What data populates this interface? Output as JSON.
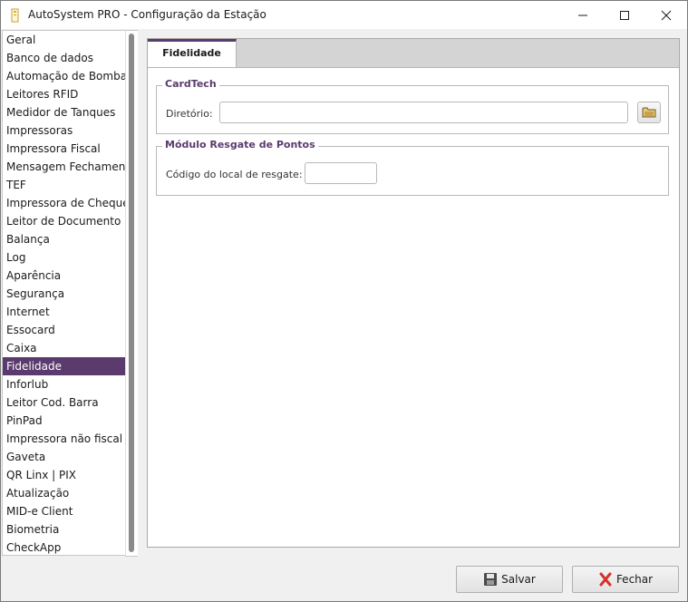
{
  "window": {
    "title": "AutoSystem PRO - Configuração da Estação"
  },
  "sidebar": {
    "selected_index": 18,
    "items": [
      {
        "label": "Geral"
      },
      {
        "label": "Banco de dados"
      },
      {
        "label": "Automação de Bombas"
      },
      {
        "label": "Leitores RFID"
      },
      {
        "label": "Medidor de Tanques"
      },
      {
        "label": "Impressoras"
      },
      {
        "label": "Impressora Fiscal"
      },
      {
        "label": "Mensagem Fechamento"
      },
      {
        "label": "TEF"
      },
      {
        "label": "Impressora de Cheque"
      },
      {
        "label": "Leitor de Documento"
      },
      {
        "label": "Balança"
      },
      {
        "label": "Log"
      },
      {
        "label": "Aparência"
      },
      {
        "label": "Segurança"
      },
      {
        "label": "Internet"
      },
      {
        "label": "Essocard"
      },
      {
        "label": "Caixa"
      },
      {
        "label": "Fidelidade"
      },
      {
        "label": "Inforlub"
      },
      {
        "label": "Leitor Cod. Barra"
      },
      {
        "label": "PinPad"
      },
      {
        "label": "Impressora não fiscal"
      },
      {
        "label": "Gaveta"
      },
      {
        "label": "QR Linx | PIX"
      },
      {
        "label": "Atualização"
      },
      {
        "label": "MID-e Client"
      },
      {
        "label": "Biometria"
      },
      {
        "label": "CheckApp"
      }
    ]
  },
  "main": {
    "tab_label": "Fidelidade",
    "cardtech": {
      "title": "CardTech",
      "directory_label": "Diretório:",
      "directory_value": ""
    },
    "points": {
      "title": "Módulo Resgate de Pontos",
      "location_label": "Código do local de resgate:",
      "location_value": ""
    }
  },
  "buttons": {
    "save": "Salvar",
    "close": "Fechar"
  },
  "colors": {
    "accent": "#5b3a6e",
    "close_icon": "#d9302c"
  }
}
